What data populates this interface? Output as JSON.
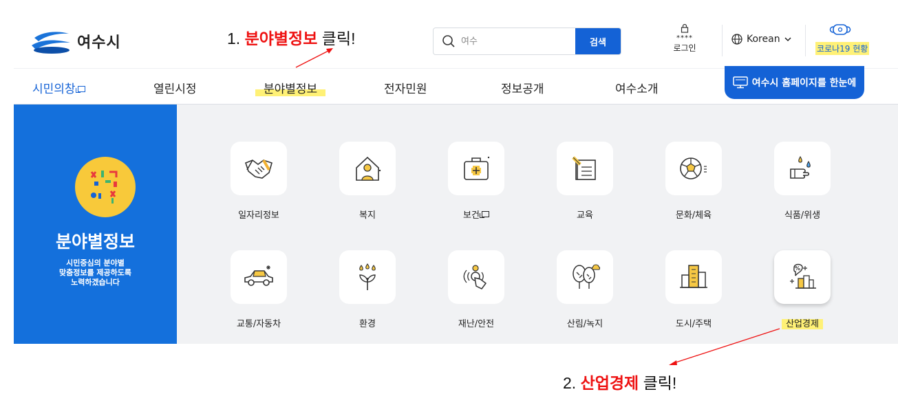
{
  "header": {
    "logo_text": "여수시",
    "search": {
      "placeholder": "여수",
      "button_label": "검색"
    },
    "login": {
      "stars": "****",
      "label": "로그인"
    },
    "language": "Korean",
    "corona": "코로나19 현황"
  },
  "annotations": {
    "step1_prefix": "1. ",
    "step1_target": "분야별정보",
    "step1_suffix": " 클릭!",
    "step2_prefix": "2. ",
    "step2_target": "산업경제",
    "step2_suffix": " 클릭!"
  },
  "nav": {
    "items": [
      "시민의창",
      "열린시정",
      "분야별정보",
      "전자민원",
      "정보공개",
      "여수소개"
    ],
    "overview_button": "여수시 홈페이지를 한눈에"
  },
  "panel": {
    "title": "분야별정보",
    "description": "시민중심의 분야별\n맞춤정보를 제공하도록\n노력하겠습니다"
  },
  "categories": [
    {
      "label": "일자리정보",
      "icon": "handshake-icon"
    },
    {
      "label": "복지",
      "icon": "house-person-icon"
    },
    {
      "label": "보건",
      "icon": "medical-kit-icon"
    },
    {
      "label": "교육",
      "icon": "book-pencil-icon"
    },
    {
      "label": "문화/체육",
      "icon": "soccer-ball-icon"
    },
    {
      "label": "식품/위생",
      "icon": "hand-wash-icon"
    },
    {
      "label": "교통/자동차",
      "icon": "car-icon"
    },
    {
      "label": "환경",
      "icon": "sprout-icon"
    },
    {
      "label": "재난/안전",
      "icon": "alarm-press-icon"
    },
    {
      "label": "산림/녹지",
      "icon": "trees-icon"
    },
    {
      "label": "도시/주택",
      "icon": "buildings-icon"
    },
    {
      "label": "산업경제",
      "icon": "industry-percent-icon"
    }
  ],
  "colors": {
    "primary": "#1462d6",
    "highlight": "#fff176",
    "annotation": "#ee1111",
    "panel": "#1470dc",
    "grid_bg": "#f1f2f4"
  }
}
